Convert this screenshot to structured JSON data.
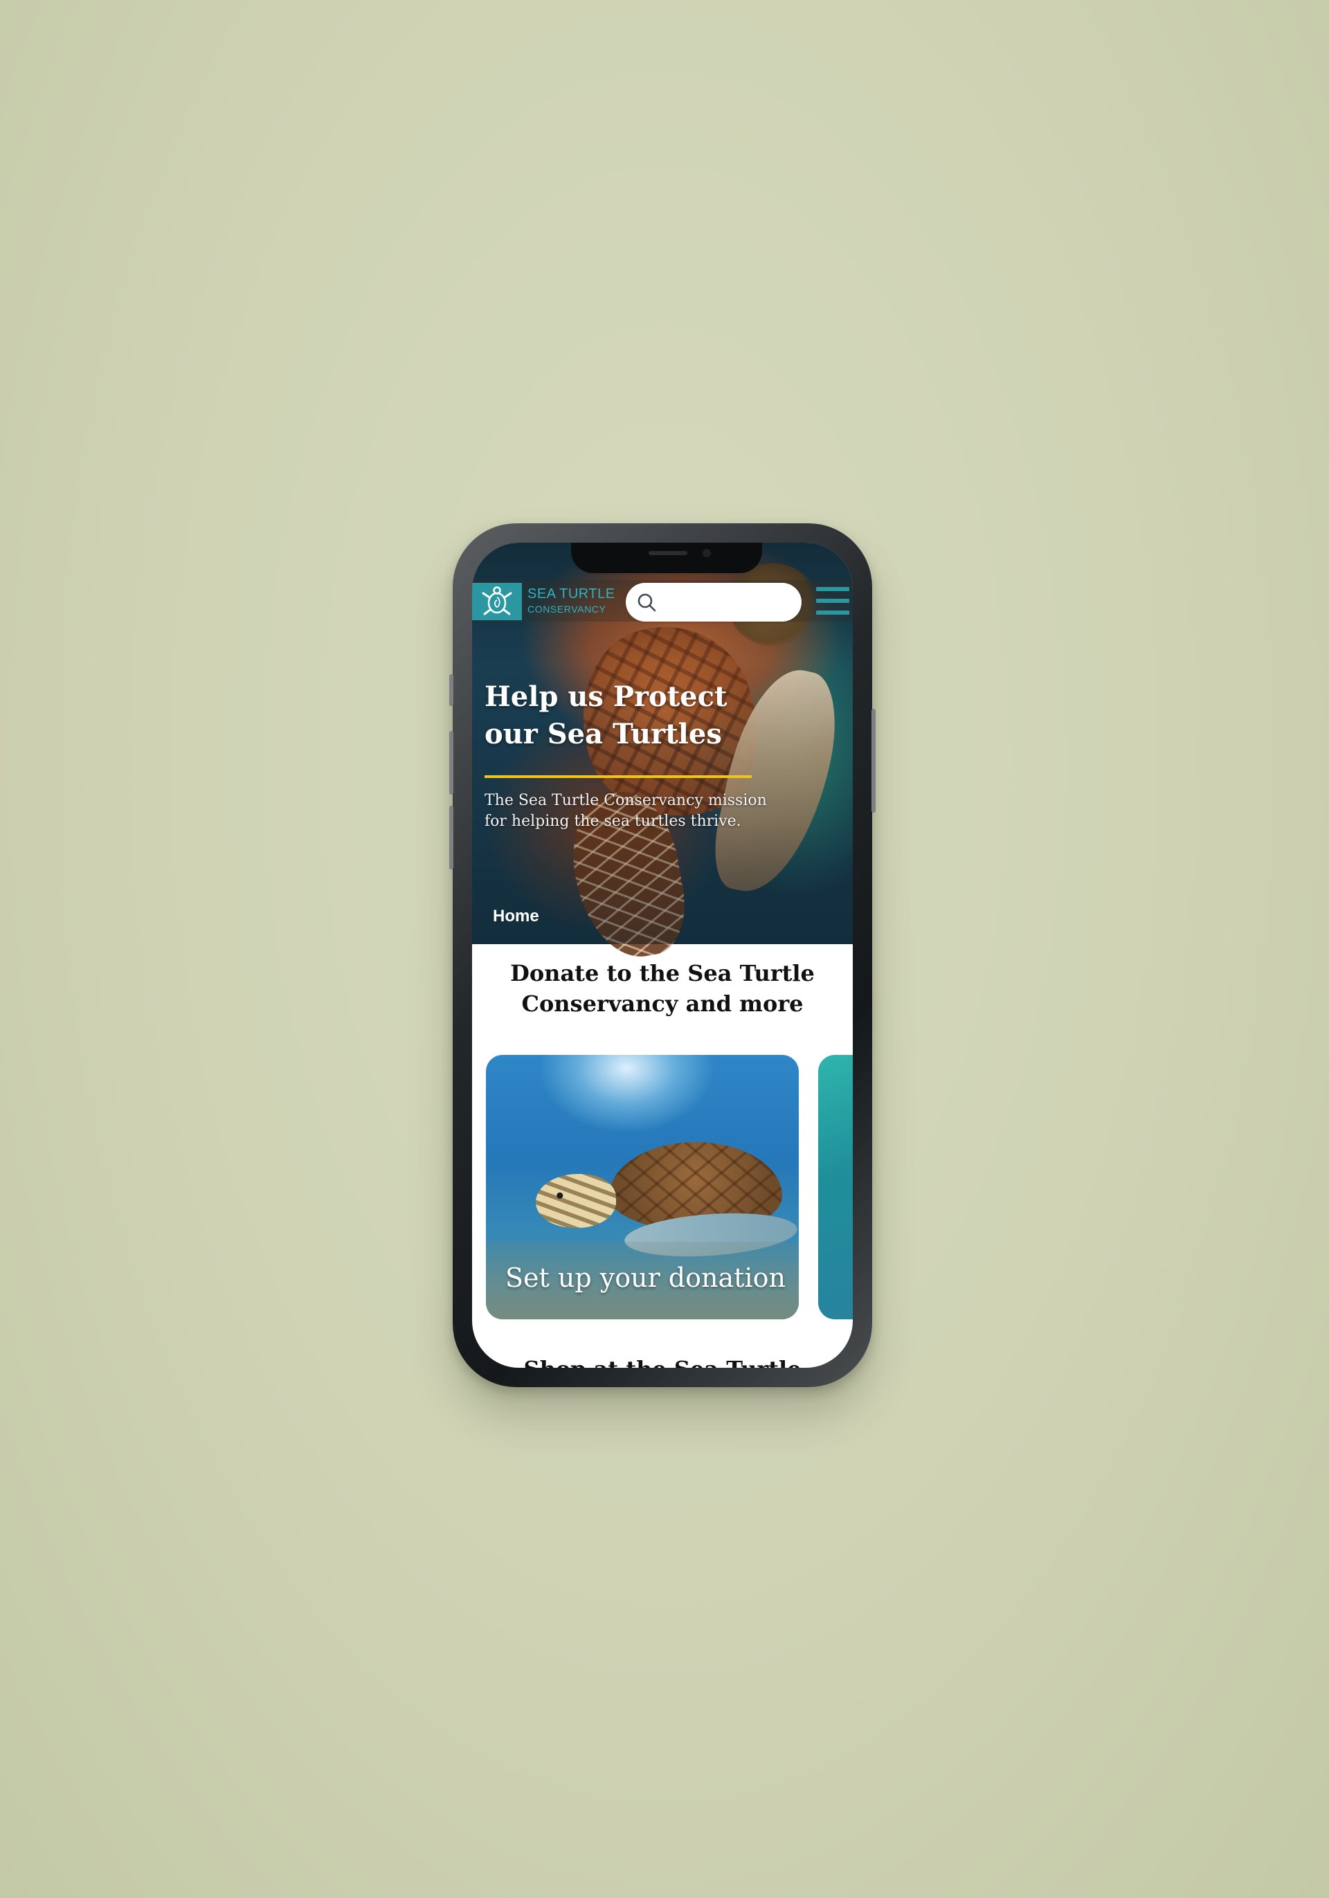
{
  "header": {
    "logo_line1": "SEA TURTLE",
    "logo_line2": "CONSERVANCY",
    "search_placeholder": "",
    "accent_color": "#2a97a1"
  },
  "hero": {
    "title": "Help us Protect our Sea Turtles",
    "subtitle": "The Sea Turtle Conservancy mission for helping the sea turtles thrive.",
    "breadcrumb": "Home",
    "underline_color": "#f0c419"
  },
  "donate_section": {
    "title": "Donate to the Sea Turtle Conservancy and more",
    "cards": [
      {
        "caption": "Set up your donation"
      }
    ]
  },
  "shop_section": {
    "title": "Shop at the Sea Turtle"
  },
  "icons": [
    "turtle-logo-icon",
    "search-icon",
    "hamburger-menu-icon"
  ]
}
